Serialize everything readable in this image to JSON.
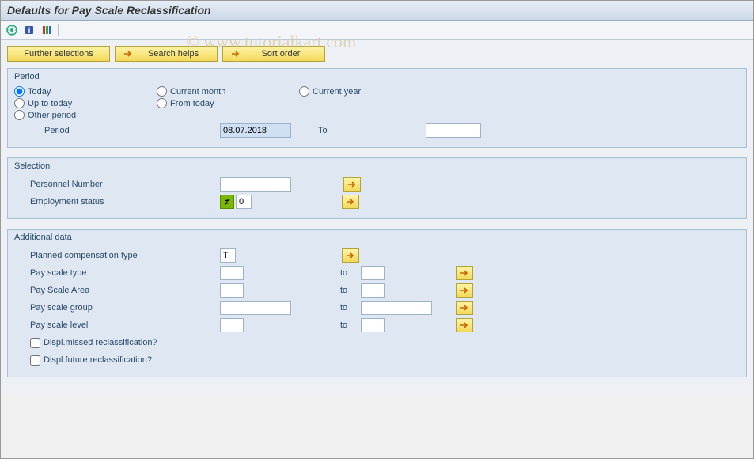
{
  "title": "Defaults for Pay Scale Reclassification",
  "watermark": "© www.tutorialkart.com",
  "actions": {
    "further_selections": "Further selections",
    "search_helps": "Search helps",
    "sort_order": "Sort order"
  },
  "groups": {
    "period": {
      "legend": "Period",
      "options": {
        "today": "Today",
        "current_month": "Current month",
        "current_year": "Current year",
        "up_to_today": "Up to today",
        "from_today": "From today",
        "other_period": "Other period"
      },
      "period_label": "Period",
      "period_from": "08.07.2018",
      "to_label": "To",
      "period_to": ""
    },
    "selection": {
      "legend": "Selection",
      "personnel_number": {
        "label": "Personnel Number",
        "value": ""
      },
      "employment_status": {
        "label": "Employment status",
        "value": "0",
        "operator": "≠"
      }
    },
    "additional": {
      "legend": "Additional data",
      "planned_comp_type": {
        "label": "Planned compensation type",
        "value": "T"
      },
      "to_label": "to",
      "pay_scale_type": {
        "label": "Pay scale type",
        "from": "",
        "to": ""
      },
      "pay_scale_area": {
        "label": "Pay Scale Area",
        "from": "",
        "to": ""
      },
      "pay_scale_group": {
        "label": "Pay scale group",
        "from": "",
        "to": ""
      },
      "pay_scale_level": {
        "label": "Pay scale level",
        "from": "",
        "to": ""
      },
      "displ_missed": "Displ.missed reclassification?",
      "displ_future": "Displ.future reclassification?"
    }
  }
}
